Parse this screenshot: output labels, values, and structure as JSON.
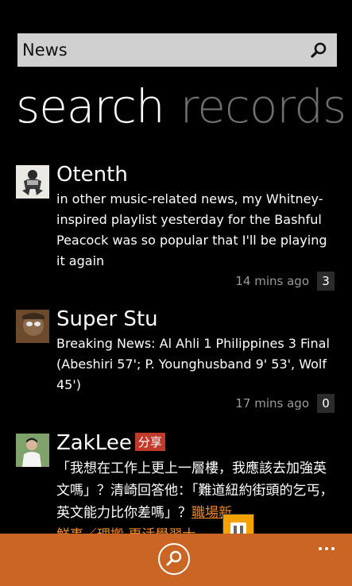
{
  "search": {
    "value": "News",
    "icon": "search-icon"
  },
  "pivot": {
    "items": [
      "search",
      "records"
    ]
  },
  "feed": [
    {
      "name": "Otenth",
      "message": "in other music-related news, my Whitney-inspired playlist yesterday for the Bashful Peacock was so popular that I'll be playing it again",
      "time": "14 mins ago",
      "count": "3"
    },
    {
      "name": "Super Stu",
      "message": "Breaking News: Al Ahli 1 Philippines 3 Final (Abeshiri 57'; P. Younghusband 9' 53', Wolf 45')",
      "time": "17 mins ago",
      "count": "0"
    },
    {
      "name": "ZakLee",
      "badge": "分享",
      "message": "「我想在工作上更上一層樓，我應該去加強英文嗎」？清崎回答他：「難道紐約街頭的乞丐，英文能力比你差嗎」？",
      "link": "職場新",
      "message_cut": "鮮事／理搬 更活學習士"
    }
  ],
  "appbar": {
    "primary_icon": "search-icon",
    "more_icon": "ellipsis-icon"
  },
  "colors": {
    "accent": "#ca6524",
    "background": "#000000",
    "search_bg": "#d0d0d0",
    "badge": "#c0392b",
    "link": "#f08a24"
  }
}
